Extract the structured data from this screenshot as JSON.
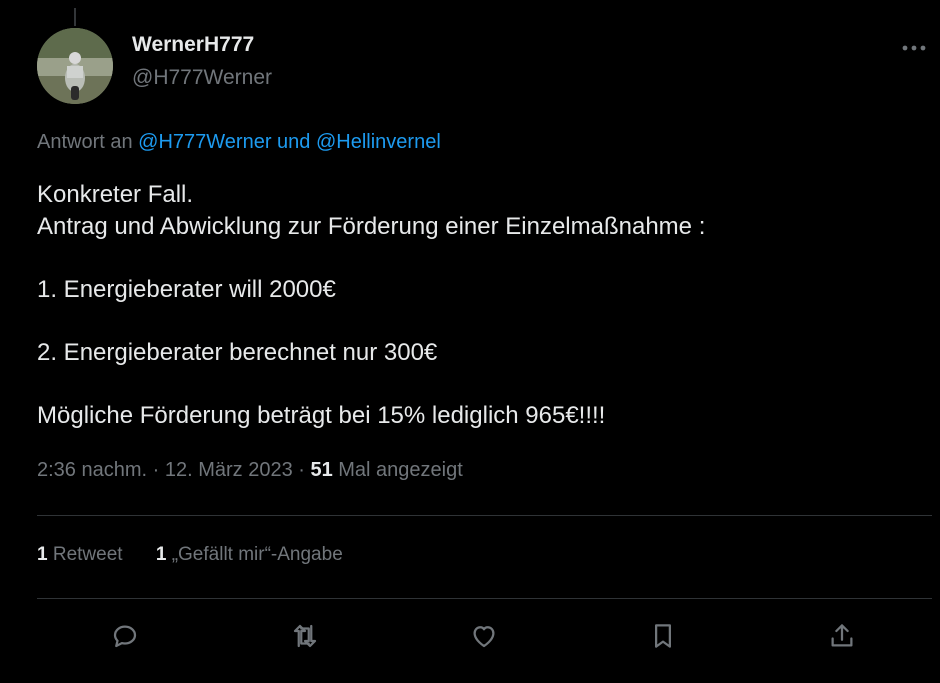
{
  "author": {
    "display_name": "WernerH777",
    "handle": "@H777Werner",
    "avatar_icon": "motorcycle-avatar"
  },
  "reply": {
    "prefix": "Antwort an ",
    "mentions": "@H777Werner und @Hellinvernel"
  },
  "body": {
    "line1": "Konkreter Fall.",
    "line2": "Antrag und Abwicklung zur Förderung einer Einzelmaßnahme :",
    "line3": "1. Energieberater will 2000€",
    "line4": "2. Energieberater berechnet nur 300€",
    "line5": "Mögliche Förderung beträgt bei 15% lediglich 965€!!!!"
  },
  "meta": {
    "timestamp": "2:36 nachm. · 12. März 2023 · ",
    "views_count": "51",
    "views_label": " Mal angezeigt"
  },
  "stats": {
    "retweets_count": "1",
    "retweets_label": " Retweet",
    "likes_count": "1",
    "likes_label": " „Gefällt mir“-Angabe"
  },
  "actions": [
    "reply-icon",
    "retweet-icon",
    "like-icon",
    "bookmark-icon",
    "share-icon"
  ],
  "colors": {
    "background": "#000000",
    "text": "#e7e9ea",
    "secondary": "#71767b",
    "link": "#1d9bf0",
    "divider": "#2f3336"
  }
}
